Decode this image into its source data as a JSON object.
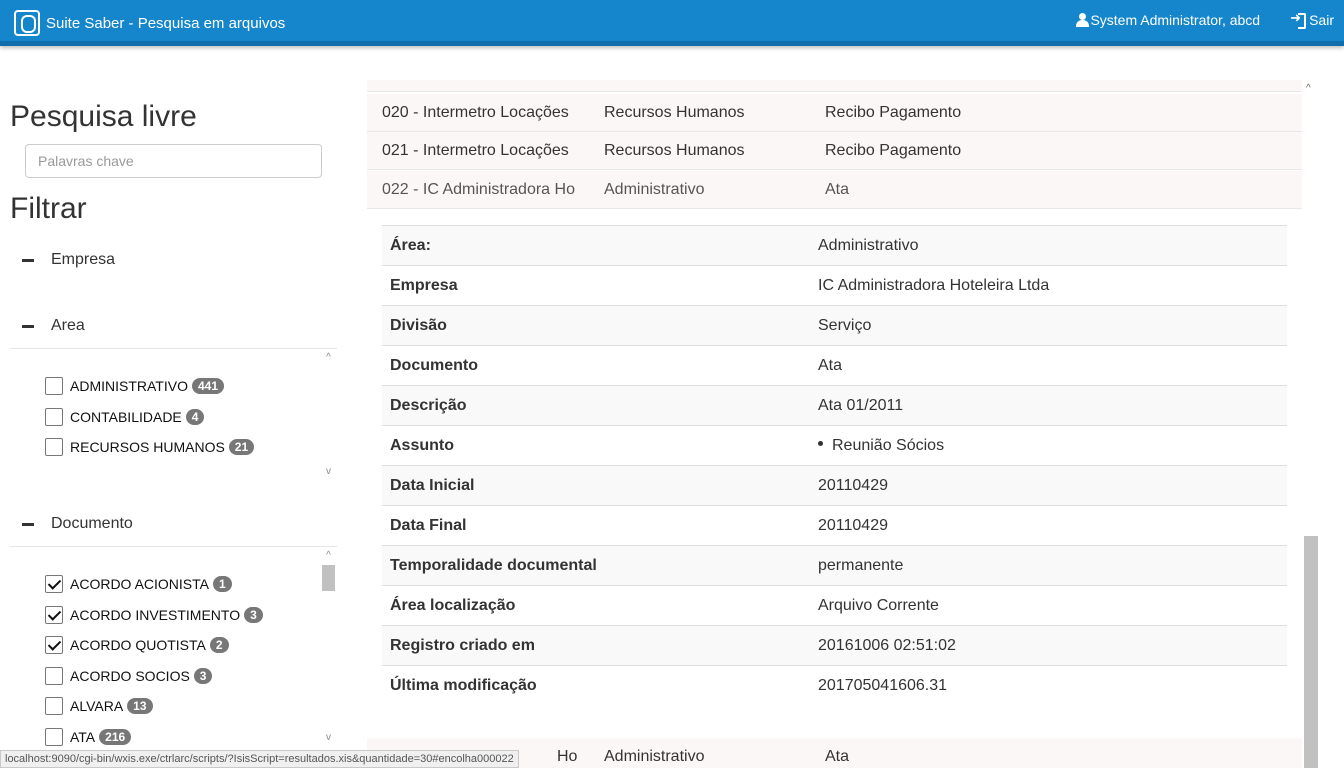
{
  "header": {
    "app_title": "Suite Saber - Pesquisa em arquivos",
    "user_label": "System Administrator, abcd",
    "logout_label": "Sair"
  },
  "sidebar": {
    "search_title": "Pesquisa livre",
    "search_placeholder": "Palavras chave",
    "filter_title": "Filtrar",
    "facets": {
      "empresa": {
        "label": "Empresa"
      },
      "area": {
        "label": "Area",
        "items": [
          {
            "label": "ADMINISTRATIVO",
            "count": "441",
            "checked": false
          },
          {
            "label": "CONTABILIDADE",
            "count": "4",
            "checked": false
          },
          {
            "label": "RECURSOS HUMANOS",
            "count": "21",
            "checked": false
          }
        ]
      },
      "documento": {
        "label": "Documento",
        "items": [
          {
            "label": "ACORDO ACIONISTA",
            "count": "1",
            "checked": true
          },
          {
            "label": "ACORDO INVESTIMENTO",
            "count": "3",
            "checked": true
          },
          {
            "label": "ACORDO QUOTISTA",
            "count": "2",
            "checked": true
          },
          {
            "label": "ACORDO SOCIOS",
            "count": "3",
            "checked": false
          },
          {
            "label": "ALVARA",
            "count": "13",
            "checked": false
          },
          {
            "label": "ATA",
            "count": "216",
            "checked": false
          }
        ]
      }
    }
  },
  "results": {
    "rows": [
      {
        "empresa": "020 - Intermetro Locações",
        "area": "Recursos Humanos",
        "documento": "Recibo Pagamento"
      },
      {
        "empresa": "021 - Intermetro Locações",
        "area": "Recursos Humanos",
        "documento": "Recibo Pagamento"
      },
      {
        "empresa": "022 - IC Administradora Ho",
        "area": "Administrativo",
        "documento": "Ata"
      }
    ],
    "bottom_row": {
      "empresa": "Ho",
      "area": "Administrativo",
      "documento": "Ata"
    },
    "detail": [
      {
        "label": "Área:",
        "value": "Administrativo"
      },
      {
        "label": "Empresa",
        "value": "IC Administradora Hoteleira Ltda"
      },
      {
        "label": "Divisão",
        "value": "Serviço"
      },
      {
        "label": "Documento",
        "value": "Ata"
      },
      {
        "label": "Descrição",
        "value": "Ata 01/2011"
      },
      {
        "label": "Assunto",
        "value": "Reunião Sócios"
      },
      {
        "label": "Data Inicial",
        "value": "20110429"
      },
      {
        "label": "Data Final",
        "value": "20110429"
      },
      {
        "label": "Temporalidade documental",
        "value": "permanente"
      },
      {
        "label": "Área localização",
        "value": "Arquivo Corrente"
      },
      {
        "label": "Registro criado em",
        "value": "20161006 02:51:02"
      },
      {
        "label": "Última modificação",
        "value": "201705041606.31"
      }
    ]
  },
  "status_url": "localhost:9090/cgi-bin/wxis.exe/ctrlarc/scripts/?IsisScript=resultados.xis&quantidade=30#encolha000022"
}
